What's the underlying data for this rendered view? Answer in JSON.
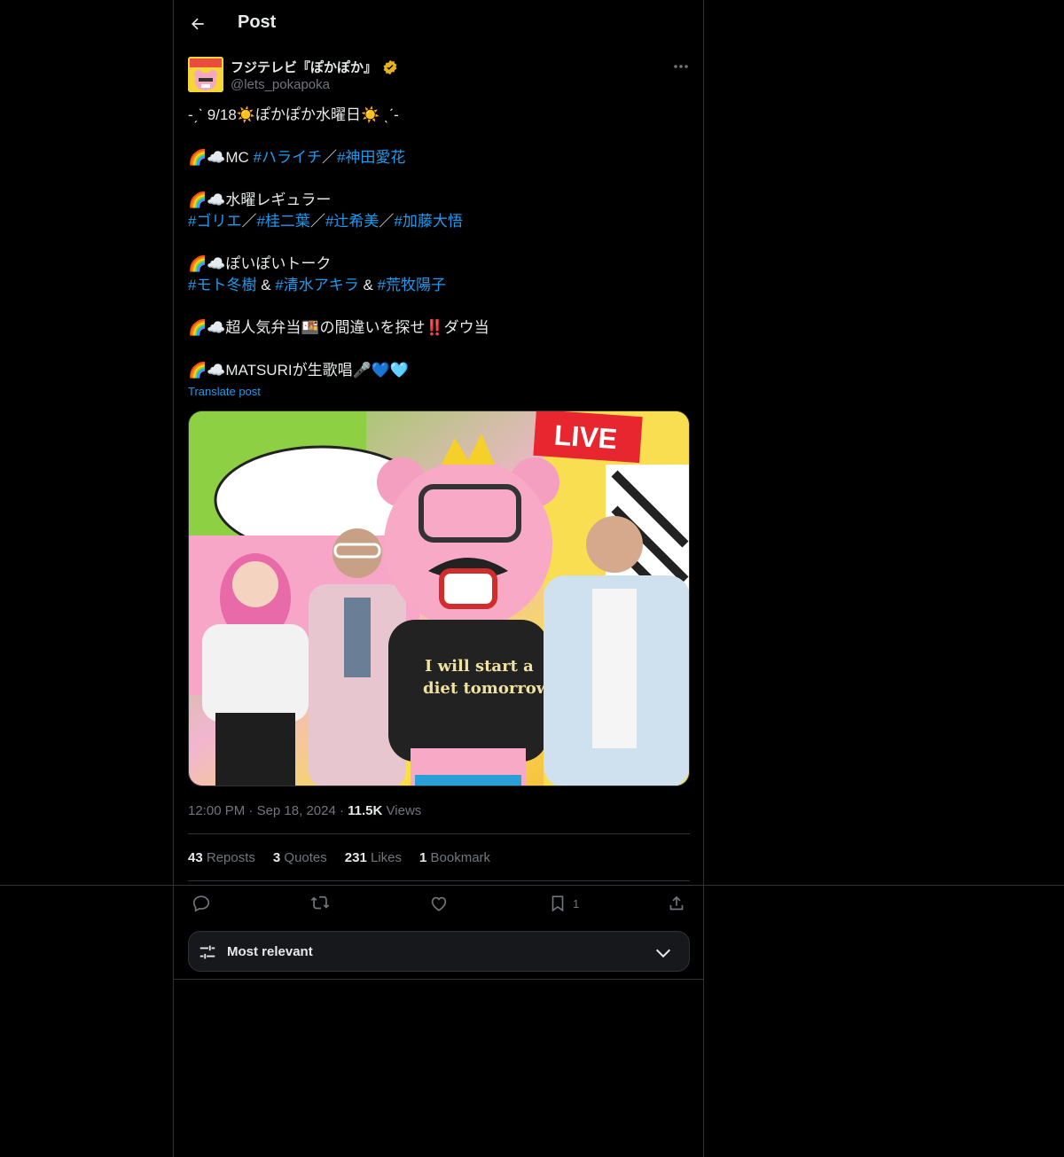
{
  "header": {
    "title": "Post"
  },
  "author": {
    "display_name": "フジテレビ『ぽかぽか』",
    "handle": "@lets_pokapoka",
    "verified_color": "#e8b21a"
  },
  "post": {
    "lines": [
      {
        "text": "-ˏˋ 9/18☀️ぽかぽか水曜日☀️ ˎˊ-"
      },
      {
        "prefix": "🌈☁️MC ",
        "tags": [
          "#ハライチ",
          "#神田愛花"
        ],
        "sep": "／"
      },
      {
        "text": "🌈☁️水曜レギュラー"
      },
      {
        "tags": [
          "#ゴリエ",
          "#桂二葉",
          "#辻希美",
          "#加藤大悟"
        ],
        "sep": "／"
      },
      {
        "text": "🌈☁️ぽいぽいトーク"
      },
      {
        "tags": [
          "#モト冬樹",
          "#清水アキラ",
          "#荒牧陽子"
        ],
        "sep": " & "
      },
      {
        "text": "🌈☁️超人気弁当🍱の間違いを探せ‼️ダウ当"
      },
      {
        "text": "🌈☁️MATSURIが生歌唱🎤💙🩵"
      }
    ],
    "translate_label": "Translate post",
    "image": {
      "live_badge": "LIVE",
      "shirt_text_line1": "I will start a",
      "shirt_text_line2": "diet tomorrow"
    }
  },
  "meta": {
    "time": "12:00 PM",
    "date": "Sep 18, 2024",
    "views_count": "11.5K",
    "views_label": "Views"
  },
  "stats": {
    "reposts_count": "43",
    "reposts_label": "Reposts",
    "quotes_count": "3",
    "quotes_label": "Quotes",
    "likes_count": "231",
    "likes_label": "Likes",
    "bookmarks_count": "1",
    "bookmarks_label": "Bookmark"
  },
  "actions": {
    "reply": "reply-icon",
    "repost": "repost-icon",
    "like": "heart-icon",
    "bookmark": "bookmark-icon",
    "bookmark_count": "1",
    "share": "share-icon"
  },
  "sort": {
    "label": "Most relevant"
  },
  "colors": {
    "accent": "#1d9bf0",
    "muted": "#71767b",
    "border": "#2f3336"
  }
}
